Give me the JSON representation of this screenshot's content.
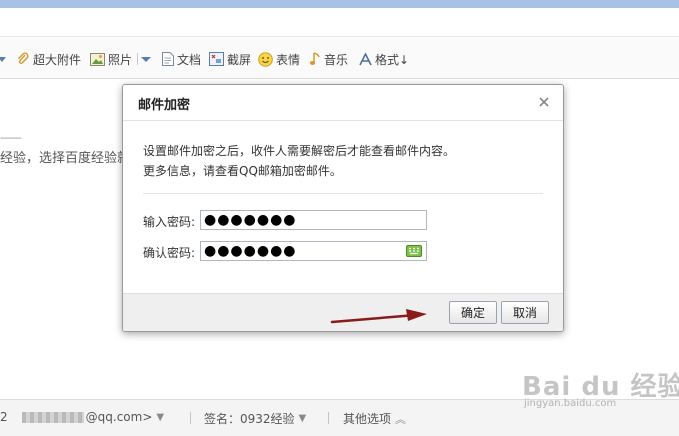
{
  "toolbar": {
    "items": [
      {
        "label": "超大附件",
        "icon": "paperclip-icon"
      },
      {
        "label": "照片",
        "icon": "photo-icon"
      },
      {
        "label": "文档",
        "icon": "document-icon"
      },
      {
        "label": "截屏",
        "icon": "screenshot-icon"
      },
      {
        "label": "表情",
        "icon": "smiley-icon"
      },
      {
        "label": "音乐",
        "icon": "music-note-icon"
      },
      {
        "label": "格式↓",
        "icon": "font-format-icon"
      }
    ]
  },
  "editor": {
    "dashes": "-------",
    "body_fragment": "经验，选择百度经验就"
  },
  "dialog": {
    "title": "邮件加密",
    "info_line1": "设置邮件加密之后，收件人需要解密后才能查看邮件内容。",
    "info_line2": "更多信息，请查看QQ邮箱加密邮件。",
    "password_label": "输入密码:",
    "password_value": "●●●●●●●",
    "confirm_label": "确认密码:",
    "confirm_value": "●●●●●●●",
    "ok_label": "确定",
    "cancel_label": "取消"
  },
  "status": {
    "sender_prefix": "2",
    "sender_suffix": "@qq.com>",
    "signature": "签名：0932经验",
    "more_options": "其他选项"
  },
  "watermark": {
    "main": "Bai du 经验",
    "sub": "jingyan.baidu.com"
  },
  "colors": {
    "top_bar": "#a9c1e6",
    "arrow": "#8b1a1a",
    "keyboard_icon": "#5aa02c"
  }
}
